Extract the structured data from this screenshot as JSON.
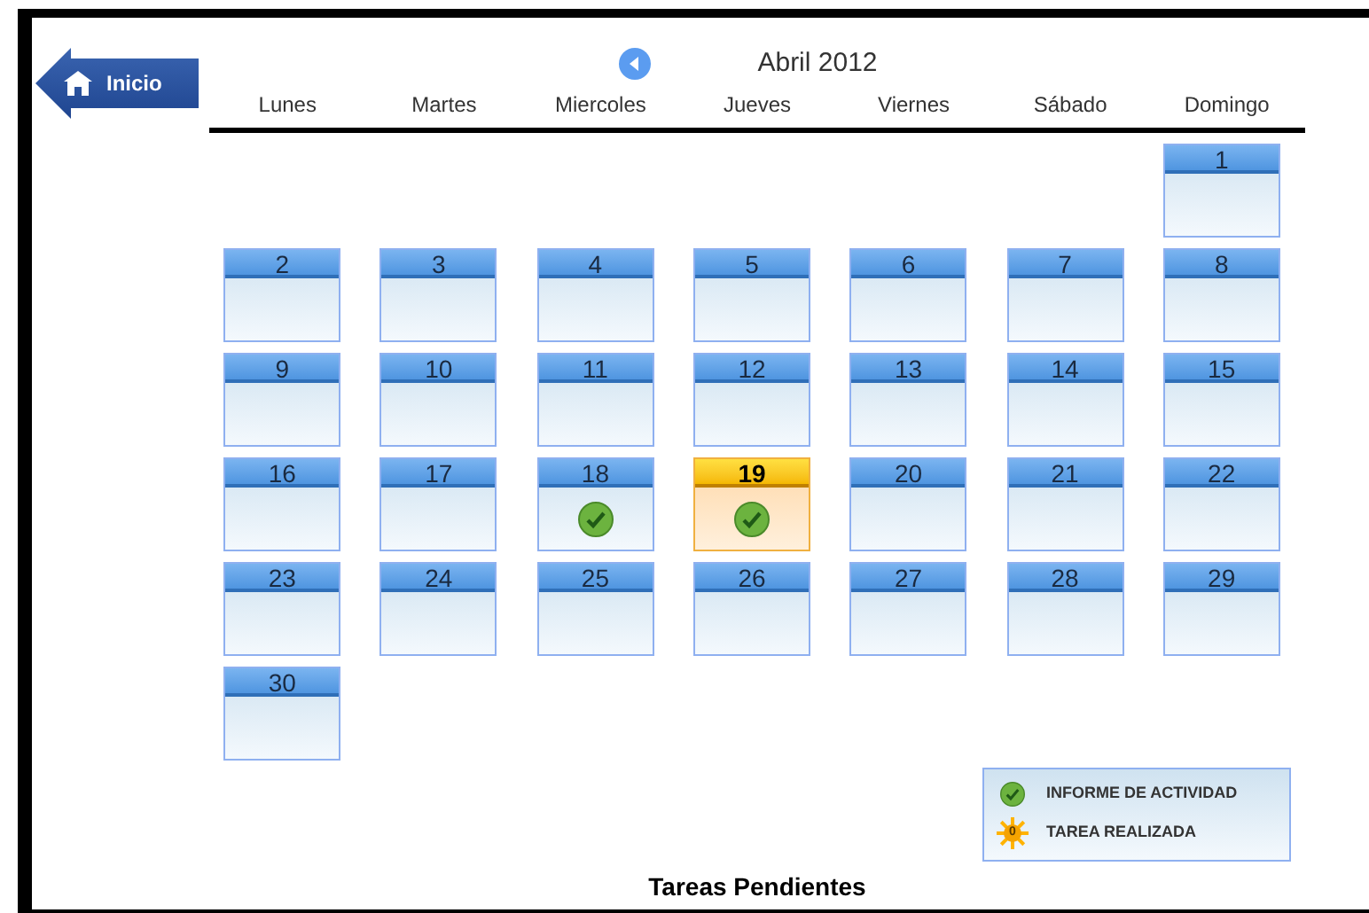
{
  "home_button": {
    "label": "Inicio"
  },
  "calendar": {
    "title": "Abril 2012",
    "weekdays": [
      "Lunes",
      "Martes",
      "Miercoles",
      "Jueves",
      "Viernes",
      "Sábado",
      "Domingo"
    ],
    "weeks": [
      [
        {
          "kind": "empty"
        },
        {
          "kind": "empty"
        },
        {
          "kind": "empty"
        },
        {
          "kind": "empty"
        },
        {
          "kind": "empty"
        },
        {
          "kind": "empty"
        },
        {
          "kind": "day",
          "label": "1",
          "today": false,
          "activity": false
        }
      ],
      [
        {
          "kind": "day",
          "label": "2",
          "today": false,
          "activity": false
        },
        {
          "kind": "day",
          "label": "3",
          "today": false,
          "activity": false
        },
        {
          "kind": "day",
          "label": "4",
          "today": false,
          "activity": false
        },
        {
          "kind": "day",
          "label": "5",
          "today": false,
          "activity": false
        },
        {
          "kind": "day",
          "label": "6",
          "today": false,
          "activity": false
        },
        {
          "kind": "day",
          "label": "7",
          "today": false,
          "activity": false
        },
        {
          "kind": "day",
          "label": "8",
          "today": false,
          "activity": false
        }
      ],
      [
        {
          "kind": "day",
          "label": "9",
          "today": false,
          "activity": false
        },
        {
          "kind": "day",
          "label": "10",
          "today": false,
          "activity": false
        },
        {
          "kind": "day",
          "label": "11",
          "today": false,
          "activity": false
        },
        {
          "kind": "day",
          "label": "12",
          "today": false,
          "activity": false
        },
        {
          "kind": "day",
          "label": "13",
          "today": false,
          "activity": false
        },
        {
          "kind": "day",
          "label": "14",
          "today": false,
          "activity": false
        },
        {
          "kind": "day",
          "label": "15",
          "today": false,
          "activity": false
        }
      ],
      [
        {
          "kind": "day",
          "label": "16",
          "today": false,
          "activity": false
        },
        {
          "kind": "day",
          "label": "17",
          "today": false,
          "activity": false
        },
        {
          "kind": "day",
          "label": "18",
          "today": false,
          "activity": true
        },
        {
          "kind": "day",
          "label": "19",
          "today": true,
          "activity": true
        },
        {
          "kind": "day",
          "label": "20",
          "today": false,
          "activity": false
        },
        {
          "kind": "day",
          "label": "21",
          "today": false,
          "activity": false
        },
        {
          "kind": "day",
          "label": "22",
          "today": false,
          "activity": false
        }
      ],
      [
        {
          "kind": "day",
          "label": "23",
          "today": false,
          "activity": false
        },
        {
          "kind": "day",
          "label": "24",
          "today": false,
          "activity": false
        },
        {
          "kind": "day",
          "label": "25",
          "today": false,
          "activity": false
        },
        {
          "kind": "day",
          "label": "26",
          "today": false,
          "activity": false
        },
        {
          "kind": "day",
          "label": "27",
          "today": false,
          "activity": false
        },
        {
          "kind": "day",
          "label": "28",
          "today": false,
          "activity": false
        },
        {
          "kind": "day",
          "label": "29",
          "today": false,
          "activity": false
        }
      ],
      [
        {
          "kind": "day",
          "label": "30",
          "today": false,
          "activity": false
        }
      ]
    ]
  },
  "legend": [
    {
      "kind": "check",
      "label": "INFORME DE ACTIVIDAD"
    },
    {
      "kind": "sun",
      "badge": "0",
      "label": "TAREA REALIZADA"
    }
  ],
  "footer": {
    "title": "Tareas Pendientes"
  }
}
